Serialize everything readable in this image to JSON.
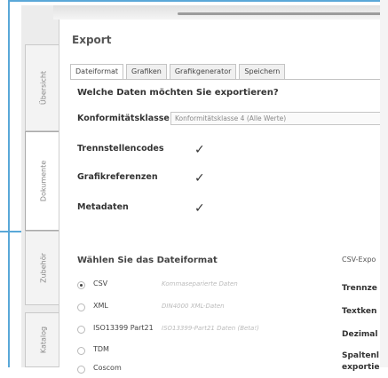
{
  "sidebar": {
    "tabs": [
      {
        "label": "Übersicht"
      },
      {
        "label": "Dokumente"
      },
      {
        "label": "Zubehör"
      },
      {
        "label": "Katalog"
      }
    ]
  },
  "export": {
    "title": "Export",
    "tabs": [
      {
        "label": "Dateiformat",
        "active": true
      },
      {
        "label": "Grafiken"
      },
      {
        "label": "Grafikgenerator"
      },
      {
        "label": "Speichern"
      }
    ],
    "question": "Welche Daten möchten Sie exportieren?",
    "konformitaet": {
      "label": "Konformitätsklasse",
      "value": "Konformitätsklasse 4 (Alle Werte)"
    },
    "options": [
      {
        "label": "Trennstellencodes",
        "checked": true
      },
      {
        "label": "Grafikreferenzen",
        "checked": true
      },
      {
        "label": "Metadaten",
        "checked": true
      }
    ],
    "check_glyph": "✓",
    "format_section": {
      "title": "Wählen Sie das Dateiformat",
      "formats": [
        {
          "name": "CSV",
          "desc": "Kommaseparierte Daten",
          "selected": true
        },
        {
          "name": "XML",
          "desc": "DIN4000 XML-Daten"
        },
        {
          "name": "ISO13399 Part21",
          "desc": "ISO13399-Part21 Daten (Beta!)"
        },
        {
          "name": "TDM",
          "desc": ""
        },
        {
          "name": "Coscom",
          "desc": ""
        }
      ]
    },
    "csv_panel": {
      "heading": "CSV-Expo",
      "labels": [
        "Trennze",
        "Textken",
        "Dezimal",
        "Spaltenl",
        "exportie"
      ]
    }
  }
}
